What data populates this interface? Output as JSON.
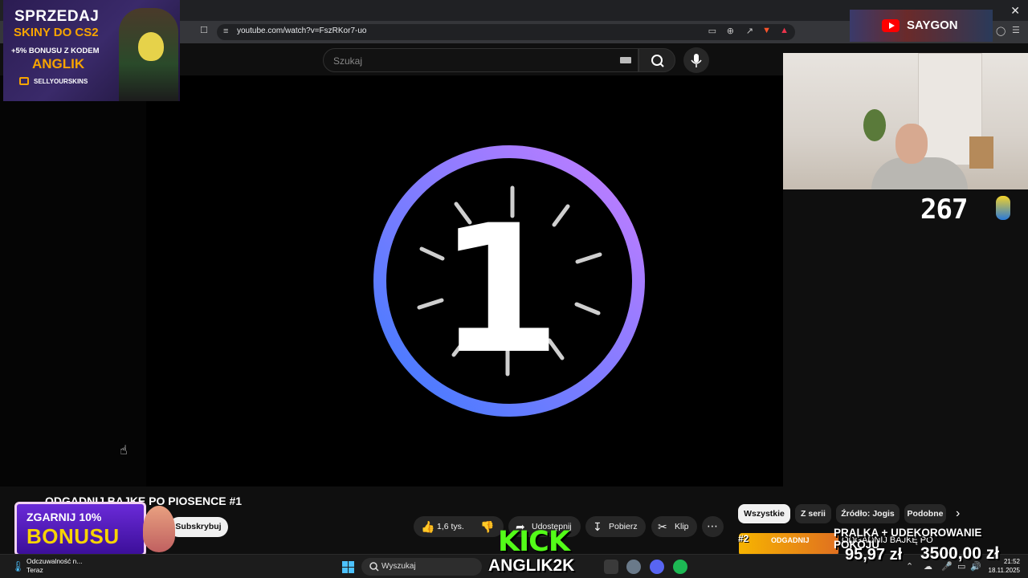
{
  "browser": {
    "url": "youtube.com/watch?v=FszRKor7-uo"
  },
  "youtube": {
    "search_placeholder": "Szukaj",
    "video_title": "ODGADNIJ BAJKĘ PO PIOSENCE #1",
    "subscribe_label": "Subskrybuj",
    "like_count": "1,6 tys.",
    "share_label": "Udostępnij",
    "download_label": "Pobierz",
    "clip_label": "Klip",
    "countdown_number": "1",
    "chips": [
      "Wszystkie",
      "Z serii",
      "Źródło: Jogis",
      "Podobne"
    ],
    "recommended": {
      "rank": "#2",
      "thumb_text": "ODGADNIJ",
      "title": "ODGADNIJ BAJKĘ PO"
    }
  },
  "overlays": {
    "promo_line1": "SPRZEDAJ",
    "promo_line2": "SKINY DO CS2",
    "promo_line3": "+5% BONUSU Z KODEM",
    "promo_line4": "ANGLIK",
    "promo_brand": "SELLYOURSKINS",
    "channel_name": "SAYGON",
    "viewer_count": "267",
    "bonus_line1": "ZGARNIJ 10%",
    "bonus_line2": "BONUSU",
    "kick_logo": "KICK",
    "kick_user": "ANGLIK2K",
    "goal_title": "PRALKA + UDEKOROWANIE POKOJU",
    "goal_current": "95,97 zł",
    "goal_target": "3500,00 zł"
  },
  "taskbar": {
    "weather_line1": "Odczuwalność n...",
    "weather_line2": "Teraz",
    "search_label": "Wyszukaj",
    "time": "21:52",
    "date": "18.11.2025"
  },
  "colors": {
    "ring_start": "#3d7bff",
    "ring_end": "#c77dff",
    "kick_green": "#53fc18",
    "yt_red": "#ff0000"
  }
}
